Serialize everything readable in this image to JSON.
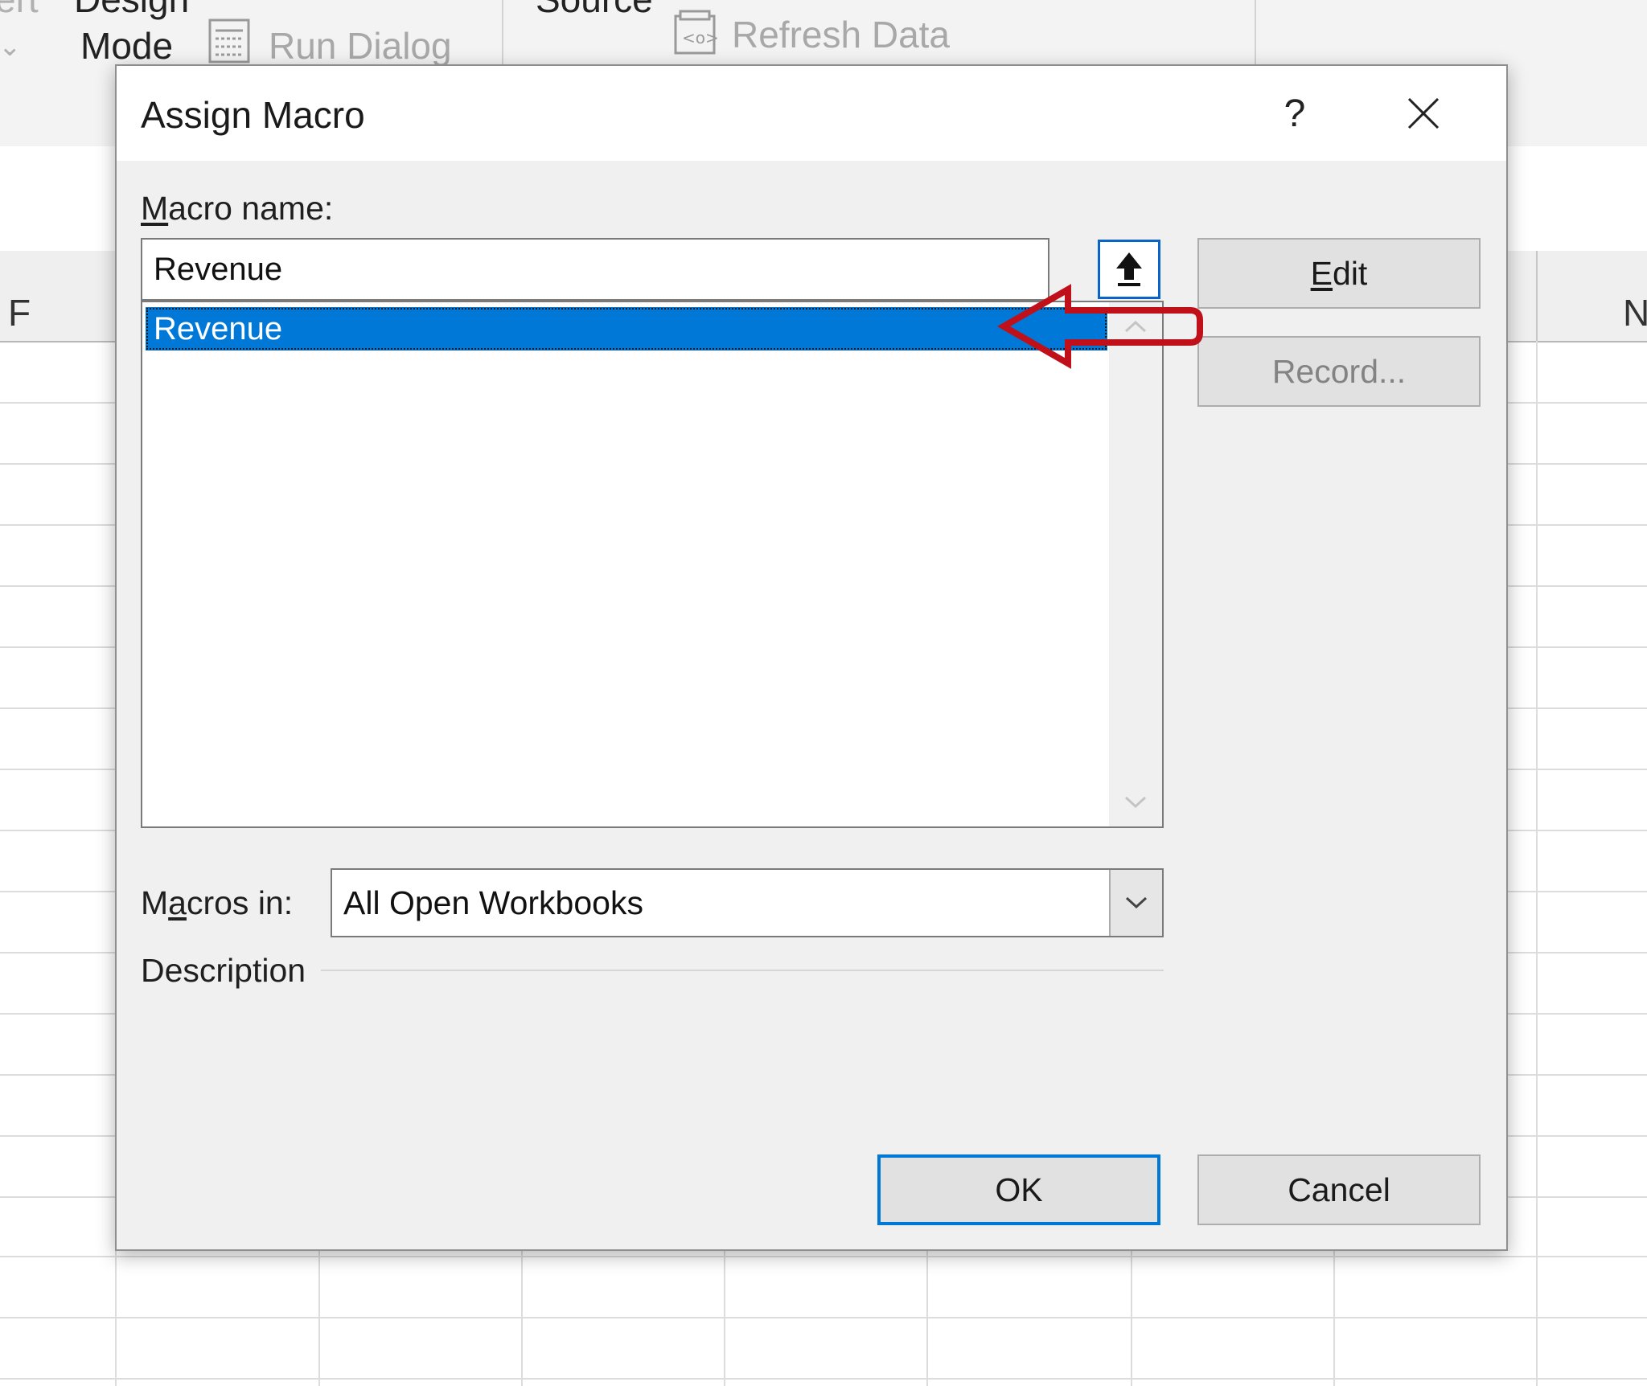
{
  "ribbon": {
    "design_label": "Design",
    "mode_label": "Mode",
    "run_dialog_label": "Run Dialog",
    "source_label": "Source",
    "refresh_data_label": "Refresh Data",
    "left_cut_label": "ert"
  },
  "sheet": {
    "visible_columns": [
      "F",
      "N"
    ]
  },
  "dialog": {
    "title": "Assign Macro",
    "help_label": "?",
    "macro_name": {
      "label_accel": "M",
      "label_rest": "acro name:",
      "value": "Revenue"
    },
    "macro_list": [
      {
        "name": "Revenue",
        "selected": true
      }
    ],
    "buttons": {
      "edit_accel": "E",
      "edit_rest": "dit",
      "record": "Record...",
      "ok": "OK",
      "cancel": "Cancel"
    },
    "macros_in": {
      "label_pre": "M",
      "label_accel": "a",
      "label_rest": "cros in:",
      "selected": "All Open Workbooks"
    },
    "description_label": "Description",
    "description_text": ""
  },
  "annotation": {
    "color": "#c0101a"
  },
  "colors": {
    "selection": "#0078d7",
    "focus_border": "#0078d7",
    "dialog_bg": "#f0f0f0"
  }
}
